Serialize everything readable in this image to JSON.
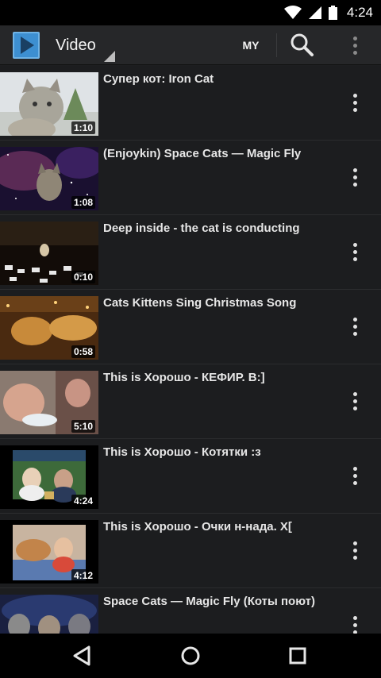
{
  "status_bar": {
    "time": "4:24",
    "icons": [
      "wifi-icon",
      "cellular-signal-icon",
      "battery-icon"
    ]
  },
  "app_bar": {
    "title": "Video",
    "my_label": "MY",
    "icons": [
      "app-logo-icon",
      "dropdown-indicator-icon",
      "search-icon",
      "overflow-menu-icon"
    ]
  },
  "videos": [
    {
      "title": "Супер кот: Iron Cat",
      "duration": "1:10"
    },
    {
      "title": "(Enjoykin) Space Cats — Magic Fly",
      "duration": "1:08"
    },
    {
      "title": "Deep inside - the cat is conducting",
      "duration": "0:10"
    },
    {
      "title": "Cats  Kittens Sing Christmas Song",
      "duration": "0:58"
    },
    {
      "title": "This is Хорошо - КЕФИР. В:]",
      "duration": "5:10"
    },
    {
      "title": "This is Хорошо - Котятки :з",
      "duration": "4:24"
    },
    {
      "title": "This is Хорошо - Очки н-нада. Х[",
      "duration": "4:12"
    },
    {
      "title": "Space Cats — Magic Fly (Коты поют)",
      "duration": ""
    }
  ],
  "nav_bar": {
    "icons": [
      "back-icon",
      "home-icon",
      "recents-icon"
    ]
  },
  "colors": {
    "background": "#1d1e20",
    "app_bar": "#262729",
    "accent": "#3d8fd1",
    "text": "#e6e6e6"
  }
}
